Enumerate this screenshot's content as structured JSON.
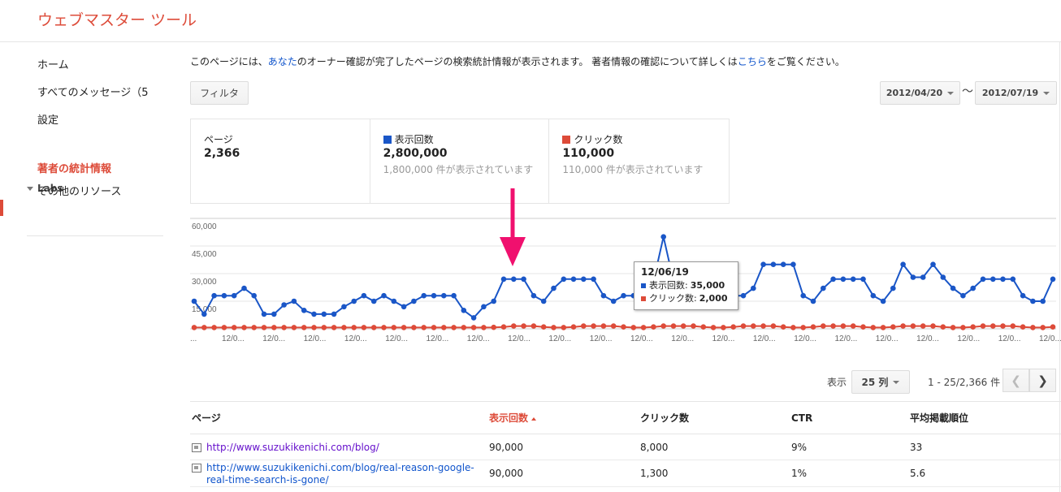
{
  "header": {
    "title": "ウェブマスター ツール"
  },
  "sidebar": {
    "items": [
      {
        "label": "ホーム"
      },
      {
        "label": "すべてのメッセージ（5"
      },
      {
        "label": "設定"
      }
    ],
    "labs_label": "Labs",
    "labs_items": [
      {
        "label": "著者の統計情報"
      },
      {
        "label": "その他のリソース"
      }
    ]
  },
  "info": {
    "pre": "このページには、",
    "link1": "あなた",
    "mid": "のオーナー確認が完了したページの検索統計情報が表示されます。 著者情報の確認について詳しくは",
    "link2": "こちら",
    "post": "をご覧ください。"
  },
  "filter_label": "フィルタ",
  "date_range": {
    "start": "2012/04/20",
    "sep": "〜",
    "end": "2012/07/19"
  },
  "stats": [
    {
      "label": "ページ",
      "value": "2,366",
      "sub": ""
    },
    {
      "label": "表示回数",
      "value": "2,800,000",
      "sub": "1,800,000 件が表示されています",
      "color": "#1a56c7"
    },
    {
      "label": "クリック数",
      "value": "110,000",
      "sub": "110,000 件が表示されています",
      "color": "#dd4b39"
    }
  ],
  "chart_data": {
    "type": "line",
    "y_ticks": [
      "60,000",
      "45,000",
      "30,000",
      "15,000"
    ],
    "ylim": [
      0,
      60000
    ],
    "x_tick_label": "12/0...",
    "x_first_label": "...",
    "series": [
      {
        "name": "表示回数",
        "color": "#1a56c7",
        "values": [
          15000,
          8000,
          18000,
          18000,
          18000,
          22000,
          18000,
          8000,
          8000,
          13000,
          15000,
          10000,
          8000,
          8000,
          8000,
          12000,
          15000,
          18000,
          15000,
          18000,
          15000,
          12000,
          15000,
          18000,
          18000,
          18000,
          18000,
          10000,
          6000,
          12000,
          15000,
          27000,
          27000,
          27000,
          18000,
          15000,
          22000,
          27000,
          27000,
          27000,
          27000,
          18000,
          15000,
          18000,
          18000,
          22000,
          26000,
          50000,
          26000,
          25000,
          24000,
          30000,
          26000,
          20000,
          18000,
          18000,
          22000,
          35000,
          35000,
          35000,
          35000,
          18000,
          15000,
          22000,
          27000,
          27000,
          27000,
          27000,
          18000,
          15000,
          22000,
          35000,
          28000,
          28000,
          35000,
          28000,
          22000,
          18000,
          22000,
          27000,
          27000,
          27000,
          27000,
          18000,
          15000,
          15000,
          27000
        ]
      },
      {
        "name": "クリック数",
        "color": "#dd4b39",
        "values": [
          700,
          700,
          700,
          700,
          700,
          700,
          700,
          700,
          700,
          700,
          700,
          700,
          700,
          700,
          700,
          700,
          700,
          700,
          700,
          700,
          700,
          700,
          700,
          700,
          700,
          700,
          700,
          700,
          700,
          700,
          800,
          1000,
          1500,
          1500,
          1500,
          1000,
          700,
          700,
          1000,
          1500,
          1500,
          1500,
          1500,
          1000,
          700,
          700,
          1000,
          1500,
          1500,
          1500,
          1500,
          1000,
          700,
          700,
          1000,
          1500,
          1500,
          1500,
          1500,
          1000,
          700,
          700,
          1000,
          1500,
          1500,
          1500,
          1500,
          1000,
          700,
          700,
          1000,
          1500,
          1500,
          1500,
          1500,
          1000,
          700,
          700,
          1000,
          1500,
          1500,
          1500,
          1500,
          1000,
          700,
          700,
          1000
        ]
      }
    ],
    "tooltip": {
      "date": "12/06/19",
      "impressions_label": "表示回数:",
      "impressions": "35,000",
      "clicks_label": "クリック数:",
      "clicks": "2,000"
    }
  },
  "pager": {
    "show_label": "表示",
    "per_page": "25 列",
    "range": "1 - 25/2,366 件"
  },
  "table": {
    "headers": [
      "ページ",
      "表示回数",
      "クリック数",
      "CTR",
      "平均掲載順位"
    ],
    "rows": [
      {
        "url": "http://www.suzukikenichi.com/blog/",
        "impressions": "90,000",
        "clicks": "8,000",
        "ctr": "9%",
        "position": "33"
      },
      {
        "url": "http://www.suzukikenichi.com/blog/real-reason-google-real-time-search-is-gone/",
        "impressions": "90,000",
        "clicks": "1,300",
        "ctr": "1%",
        "position": "5.6"
      }
    ]
  }
}
